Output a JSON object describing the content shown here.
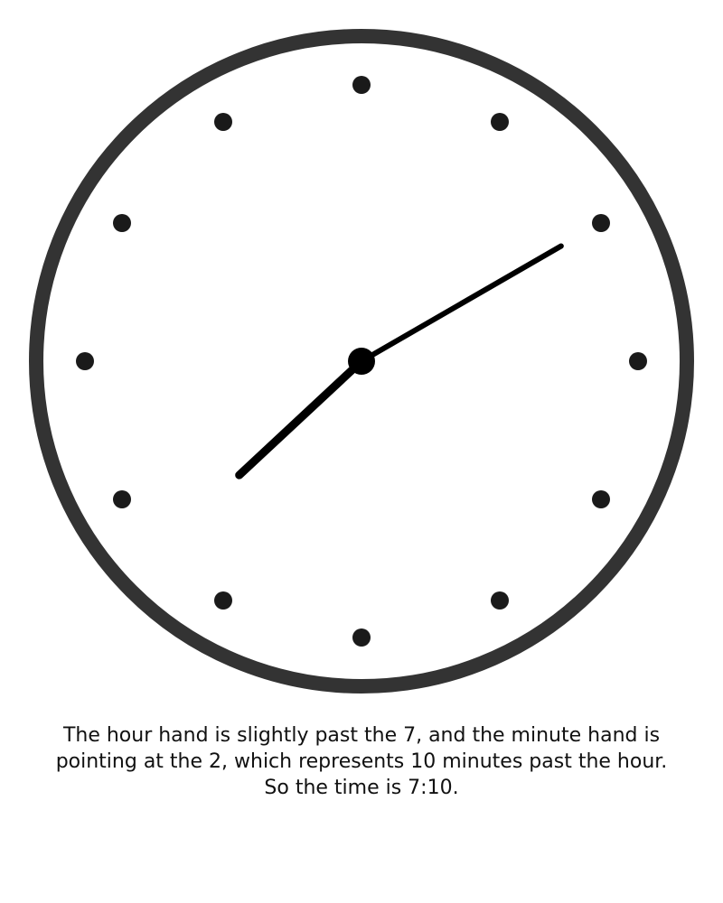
{
  "clock": {
    "time": {
      "hour": 7,
      "minute": 10
    },
    "hour_marks": 12,
    "colors": {
      "rim": "#333333",
      "face": "#ffffff",
      "hands": "#000000",
      "hour_dots": "#1a1a1a",
      "center_cap": "#000000"
    }
  },
  "caption": {
    "text": "The hour hand is slightly past the 7, and the minute hand is pointing at the 2, which represents 10 minutes past the hour. So the time is 7:10."
  }
}
